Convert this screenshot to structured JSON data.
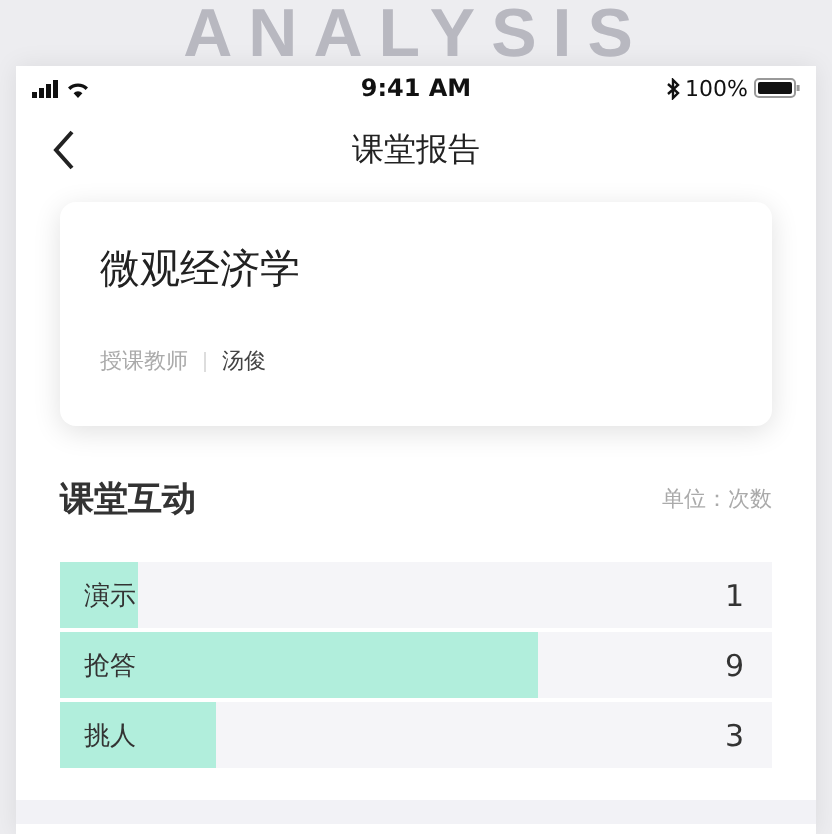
{
  "backdrop_title": "ANALYSIS",
  "status_bar": {
    "time": "9:41 AM",
    "battery": "100%"
  },
  "nav": {
    "title": "课堂报告"
  },
  "course": {
    "name": "微观经济学",
    "teacher_label": "授课教师",
    "teacher": "汤俊"
  },
  "interaction": {
    "title": "课堂互动",
    "unit": "单位：次数",
    "rows": [
      {
        "label": "演示",
        "count": "1",
        "level": 0.11
      },
      {
        "label": "抢答",
        "count": "9",
        "level": 0.67
      },
      {
        "label": "挑人",
        "count": "3",
        "level": 0.22
      }
    ]
  }
}
